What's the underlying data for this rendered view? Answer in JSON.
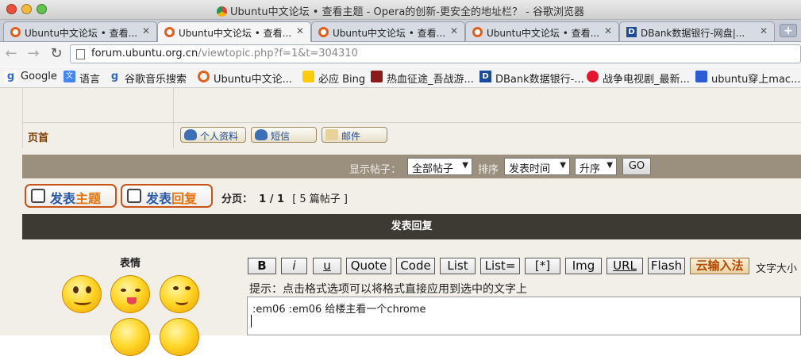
{
  "window": {
    "title": "Ubuntu中文论坛 • 查看主题 - Opera的创新-更安全的地址栏？ - 谷歌浏览器"
  },
  "tabs": [
    {
      "label": "Ubuntu中文论坛 • 查看...",
      "icon": "ubuntu-favicon",
      "active": false
    },
    {
      "label": "Ubuntu中文论坛 • 查看...",
      "icon": "ubuntu-favicon",
      "active": true
    },
    {
      "label": "Ubuntu中文论坛 • 查看...",
      "icon": "ubuntu-favicon",
      "active": false
    },
    {
      "label": "Ubuntu中文论坛 • 查看...",
      "icon": "ubuntu-favicon",
      "active": false
    },
    {
      "label": "DBank数据银行-网盘|...",
      "icon": "dbank-favicon",
      "active": false
    }
  ],
  "toolbar": {
    "url_host": "forum.ubuntu.org.cn",
    "url_path": "/viewtopic.php?f=1&t=304310"
  },
  "bookmarks": [
    {
      "label": "Google",
      "icon": "google-icon"
    },
    {
      "label": "语言",
      "icon": "translate-icon"
    },
    {
      "label": "谷歌音乐搜索",
      "icon": "google-music-icon"
    },
    {
      "label": "Ubuntu中文论...",
      "icon": "ubuntu-icon"
    },
    {
      "label": "必应 Bing",
      "icon": "bing-icon"
    },
    {
      "label": "热血征途_吾战游...",
      "icon": "game-icon"
    },
    {
      "label": "DBank数据银行-...",
      "icon": "dbank-icon"
    },
    {
      "label": "战争电视剧_最新...",
      "icon": "weibo-icon"
    },
    {
      "label": "ubuntu穿上mac...",
      "icon": "baidu-paw-icon"
    }
  ],
  "forum": {
    "home_label": "页首",
    "profile_buttons": [
      "个人资料",
      "短信",
      "邮件"
    ]
  },
  "controls": {
    "display_label": "显示帖子：",
    "display_value": "全部帖子",
    "sort_label": "排序",
    "sort_value": "发表时间",
    "order_value": "升序",
    "go_label": "GO"
  },
  "post_buttons": {
    "new_topic_a": "发表",
    "new_topic_b": "主题",
    "reply_a": "发表",
    "reply_b": "回复"
  },
  "pagination": {
    "label": "分页：",
    "pages": "1 / 1",
    "count": "[ 5 篇帖子 ]"
  },
  "reply_header": "发表回复",
  "editor": {
    "emoticons_title": "表情",
    "format_buttons": [
      "B",
      "i",
      "u",
      "Quote",
      "Code",
      "List",
      "List=",
      "[*]",
      "Img",
      "URL",
      "Flash",
      "云输入法"
    ],
    "font_size_label": "文字大小",
    "hint": "提示：点击格式选项可以将格式直接应用到选中的文字上",
    "content": ":em06  :em06 给楼主看一个chrome"
  }
}
